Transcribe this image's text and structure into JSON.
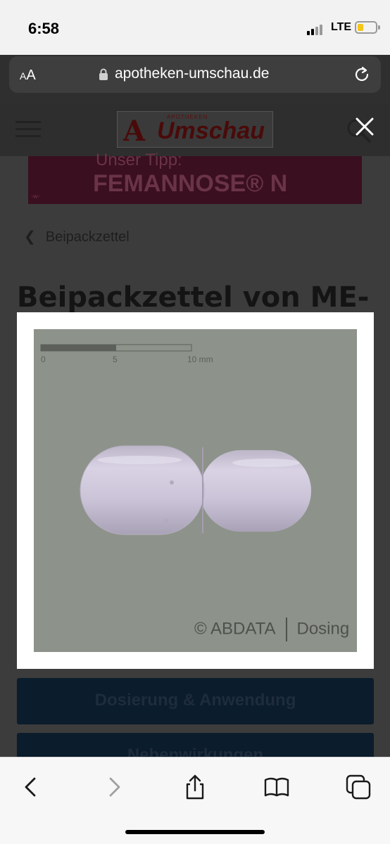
{
  "status_bar": {
    "time": "6:58",
    "network": "LTE",
    "battery_level": 0.3,
    "battery_color": "#f5c518"
  },
  "browser": {
    "text_size_label": "AA",
    "url": "apotheken-umschau.de",
    "icons": [
      "lock-icon",
      "reload-icon"
    ]
  },
  "site": {
    "logo_small": "APOTHEKEN",
    "logo_text": "Umschau",
    "logo_mark": "A",
    "ad": {
      "line1": "Unser Tipp:",
      "line2": "FEMANNOSE® N",
      "tag": "-w-"
    },
    "back_link": "Beipackzettel",
    "heading": "Beipackzettel von ME-",
    "sections": [
      "Dosierung & Anwendung",
      "Nebenwirkungen"
    ]
  },
  "lightbox": {
    "scale_labels": [
      "0",
      "5",
      "10 mm"
    ],
    "credit_left": "© ABDATA",
    "credit_right": "Dosing",
    "background_color": "#8d938a",
    "capsule_color": "#ccc5d8",
    "close_icon": "close-icon"
  },
  "toolbar": {
    "icons": [
      "back-arrow-icon",
      "forward-arrow-icon",
      "share-icon",
      "bookmarks-icon",
      "tabs-icon"
    ]
  }
}
